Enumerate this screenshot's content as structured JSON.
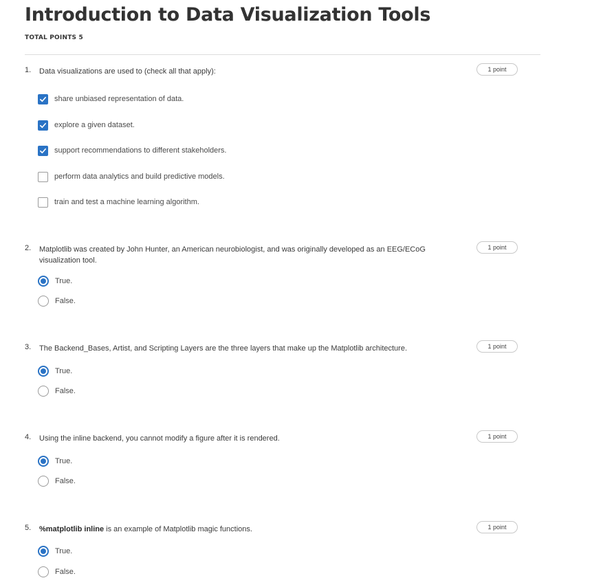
{
  "quiz": {
    "title": "Introduction to Data Visualization Tools",
    "total_points": "TOTAL POINTS 5"
  },
  "questions": [
    {
      "number": "1.",
      "text": "Data visualizations are used to (check all that apply):",
      "points": "1 point",
      "type": "checkbox",
      "options": [
        {
          "label": "share unbiased representation of data.",
          "checked": true
        },
        {
          "label": "explore a given dataset.",
          "checked": true
        },
        {
          "label": "support recommendations to different stakeholders.",
          "checked": true
        },
        {
          "label": "perform data analytics and build predictive models.",
          "checked": false
        },
        {
          "label": "train and test a machine learning algorithm.",
          "checked": false
        }
      ]
    },
    {
      "number": "2.",
      "text": "Matplotlib was created by John Hunter, an American neurobiologist, and was originally developed as an EEG/ECoG visualization tool.",
      "points": "1 point",
      "type": "radio",
      "options": [
        {
          "label": "True.",
          "checked": true
        },
        {
          "label": "False.",
          "checked": false
        }
      ]
    },
    {
      "number": "3.",
      "text": "The Backend_Bases, Artist, and Scripting Layers are the three layers that make up the Matplotlib architecture.",
      "points": "1 point",
      "type": "radio",
      "options": [
        {
          "label": "True.",
          "checked": true
        },
        {
          "label": "False.",
          "checked": false
        }
      ]
    },
    {
      "number": "4.",
      "text": "Using the inline backend, you cannot modify a figure after it is rendered.",
      "points": "1 point",
      "type": "radio",
      "options": [
        {
          "label": "True.",
          "checked": true
        },
        {
          "label": "False.",
          "checked": false
        }
      ]
    },
    {
      "number": "5.",
      "text_bold": "%matplotlib inline",
      "text": " is an example of Matplotlib magic functions.",
      "points": "1 point",
      "type": "radio",
      "options": [
        {
          "label": "True.",
          "checked": true
        },
        {
          "label": "False.",
          "checked": false
        }
      ]
    }
  ],
  "colors": {
    "accent": "#2a73c5",
    "title": "#333333",
    "text": "#3a3a3a",
    "divider": "#dcdcdc"
  }
}
